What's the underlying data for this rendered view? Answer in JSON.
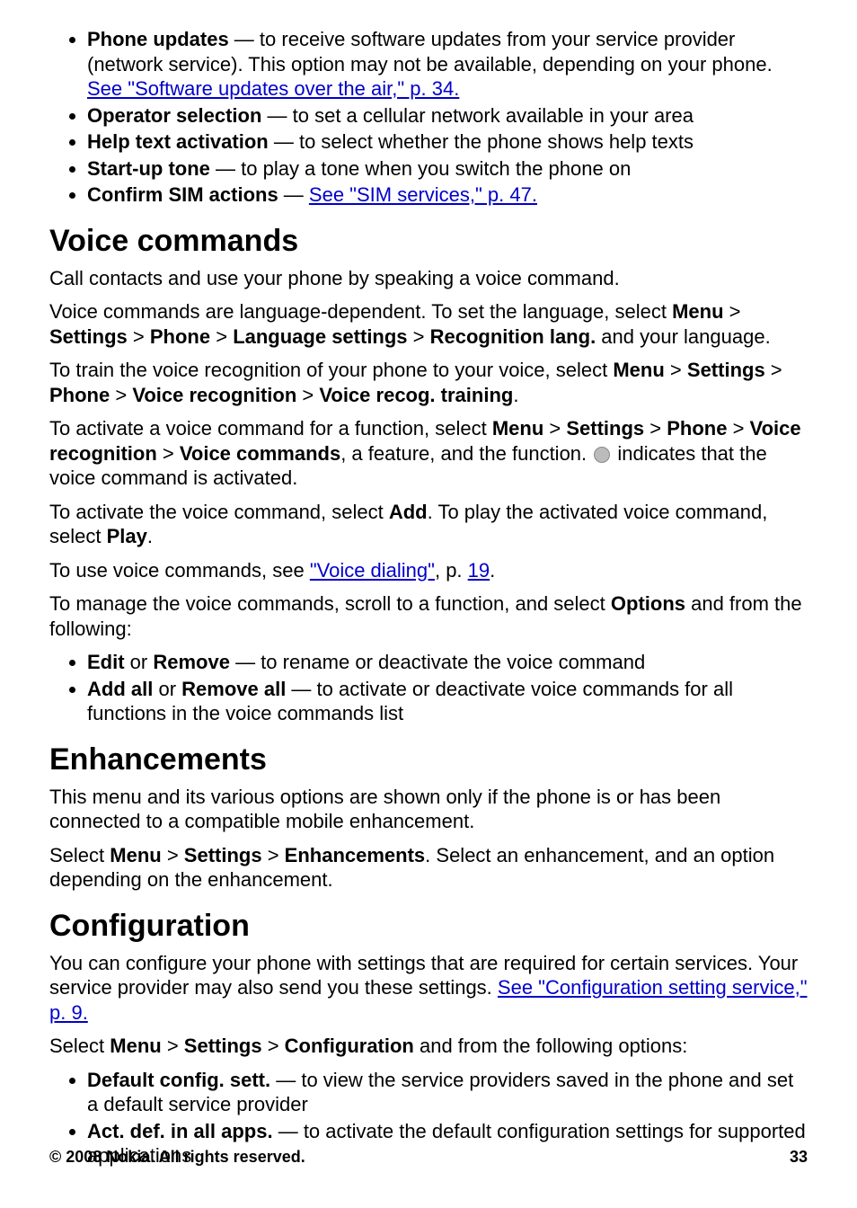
{
  "list1": {
    "i0": {
      "bold": "Phone updates",
      "sep": "  —  ",
      "text1": "to receive software updates from your service provider (network service). This option may not be available, depending on your phone. ",
      "link": "See \"Software updates over the air,\" p. 34."
    },
    "i1": {
      "bold": "Operator selection",
      "sep": "  —  ",
      "text1": "to set a cellular network available in your area"
    },
    "i2": {
      "bold": "Help text activation",
      "sep": "  —  ",
      "text1": "to select whether the phone shows help texts"
    },
    "i3": {
      "bold": "Start-up tone",
      "sep": "  —  ",
      "text1": "to play a tone when you switch the phone on"
    },
    "i4": {
      "bold": "Confirm SIM actions",
      "sep": "  —  ",
      "link": "See \"SIM services,\" p. 47."
    }
  },
  "h_voice": "Voice commands",
  "vc": {
    "p1": "Call contacts and use your phone by speaking a voice command.",
    "p2a": "Voice commands are language-dependent. To set the language, select ",
    "menu": "Menu",
    "gt": " > ",
    "settings": "Settings",
    "phone": "Phone",
    "langset": "Language settings",
    "recoglang": "Recognition lang.",
    "p2b": " and your language.",
    "p3a": "To train the voice recognition of your phone to your voice, select ",
    "voicerecog": "Voice recognition",
    "vrtraining": "Voice recog. training",
    "p4a": "To activate a voice command for a function, select ",
    "voicecmds": "Voice commands",
    "p4b": ", a feature, and the function. ",
    "p4c": " indicates that the voice command is activated.",
    "p5a": "To activate the voice command, select ",
    "add": "Add",
    "p5b": ". To play the activated voice command, select ",
    "play": "Play",
    "p6a": "To use voice commands, see ",
    "link_vd": "\"Voice dialing\"",
    "p6b": ", p. ",
    "link_19": "19",
    "p7a": "To manage the voice commands, scroll to a function, and select ",
    "options": "Options",
    "p7b": " and from the following:",
    "li1_b1": "Edit",
    "or": " or ",
    "li1_b2": "Remove",
    "li1_t": " — to rename or deactivate the voice command",
    "li2_b1": "Add all",
    "li2_b2": "Remove all",
    "li2_t": " — to activate or deactivate voice commands for all functions in the voice commands list"
  },
  "h_enh": "Enhancements",
  "enh": {
    "p1": "This menu and its various options are shown only if the phone is or has been connected to a compatible mobile enhancement.",
    "p2a": "Select ",
    "enh_b": "Enhancements",
    "p2b": ". Select an enhancement, and an option depending on the enhancement."
  },
  "h_conf": "Configuration",
  "conf": {
    "p1a": "You can configure your phone with settings that are required for certain services. Your service provider may also send you these settings. ",
    "link": "See \"Configuration setting service,\" p. 9.",
    "p2a": "Select ",
    "conf_b": "Configuration",
    "p2b": " and from the following options:",
    "li1_b": "Default config. sett.",
    "li1_t": "  —  to view the service providers saved in the phone and set a default service provider",
    "li2_b": "Act. def. in all apps.",
    "li2_t": "  —  to activate the default configuration settings for supported applications"
  },
  "footer": {
    "copyright": "© 2008 Nokia. All rights reserved.",
    "page": "33"
  },
  "dot": "."
}
